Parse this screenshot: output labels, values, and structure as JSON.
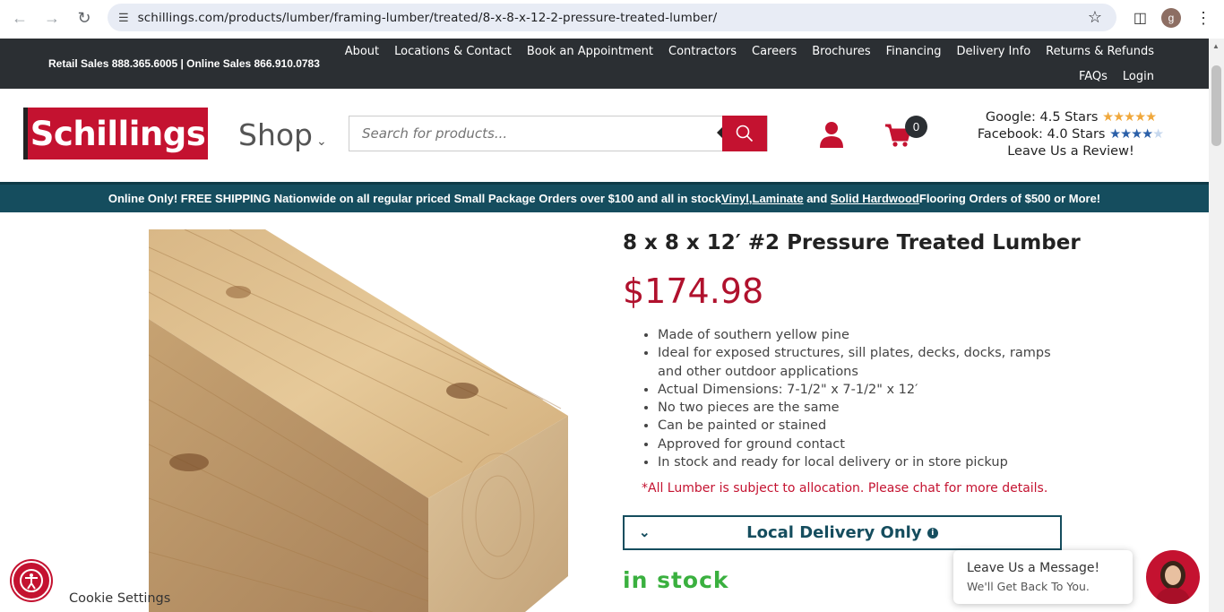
{
  "browser": {
    "url": "schillings.com/products/lumber/framing-lumber/treated/8-x-8-x-12-2-pressure-treated-lumber/",
    "profile_initial": "g"
  },
  "topbar": {
    "phones": "Retail Sales 888.365.6005 | Online Sales 866.910.0783",
    "links": [
      "About",
      "Locations & Contact",
      "Book an Appointment",
      "Contractors",
      "Careers",
      "Brochures",
      "Financing",
      "Delivery Info",
      "Returns & Refunds"
    ],
    "links2": [
      "FAQs",
      "Login"
    ]
  },
  "header": {
    "logo": "Schillings",
    "shop": "Shop",
    "search_placeholder": "Search for products...",
    "cart_count": "0",
    "google": "Google: 4.5 Stars",
    "facebook": "Facebook: 4.0 Stars",
    "review_link": "Leave Us a Review!"
  },
  "banner": {
    "pre": "Online Only! FREE SHIPPING Nationwide on all regular priced Small Package Orders over $100 and all in stock ",
    "vinyl": "Vinyl",
    "comma": ", ",
    "laminate": "Laminate",
    "and": " and ",
    "hardwood": "Solid Hardwood",
    "post": " Flooring Orders of $500 or More!"
  },
  "product": {
    "title": "8 x 8 x 12′ #2 Pressure Treated Lumber",
    "price": "$174.98",
    "bullets": [
      "Made of southern yellow pine",
      "Ideal for exposed structures, sill plates, decks, docks, ramps and other outdoor applications",
      "Actual Dimensions: 7-1/2\" x 7-1/2\" x 12′",
      "No two pieces are the same",
      "Can be painted or stained",
      "Approved for ground contact",
      "In stock and ready for local delivery or in store pickup"
    ],
    "note": "*All Lumber is subject to allocation. Please chat for more details.",
    "delivery": "Local Delivery Only",
    "stock": "in stock"
  },
  "footer": {
    "cookie": "Cookie Settings",
    "chat_title": "Leave Us a Message!",
    "chat_sub": "We'll Get Back To You."
  },
  "colors": {
    "brand_red": "#c41230",
    "teal": "#154d5e",
    "green": "#3ab03f"
  }
}
